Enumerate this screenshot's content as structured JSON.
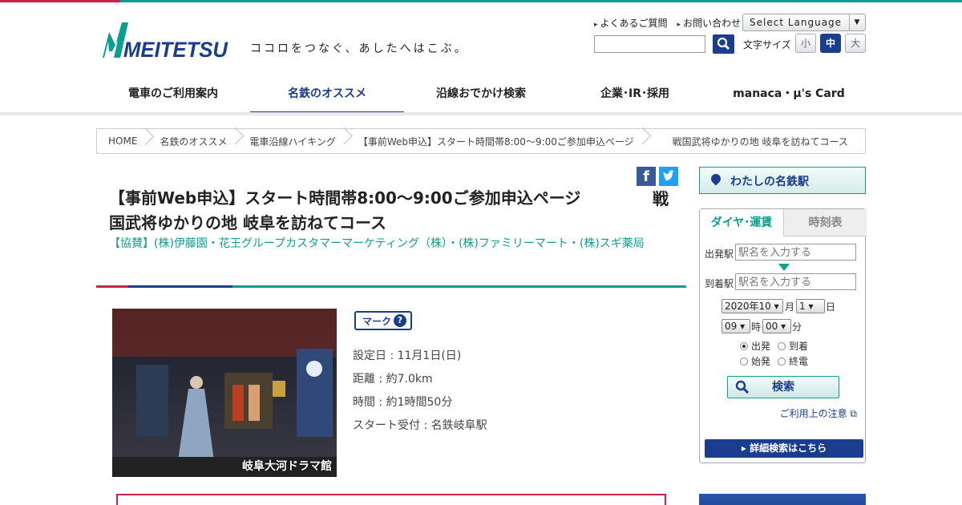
{
  "header": {
    "logo_text": "MEITETSU",
    "tagline": "ココロをつなぐ、あしたへはこぶ。",
    "util_links": [
      "よくあるご質問",
      "お問い合わせ"
    ],
    "language_select": "Select Language",
    "font_size_label": "文字サイズ",
    "font_sizes": [
      "小",
      "中",
      "大"
    ],
    "font_size_selected": "中"
  },
  "nav": {
    "items": [
      "電車のご利用案内",
      "名鉄のオススメ",
      "沿線おでかけ検索",
      "企業･IR･採用",
      "manaca・μ's Card"
    ],
    "active": "名鉄のオススメ"
  },
  "breadcrumb": [
    "HOME",
    "名鉄のオススメ",
    "電車沿線ハイキング",
    "【事前Web申込】スタート時間帯8:00～9:00ご参加申込ページ",
    "戦国武将ゆかりの地 岐阜を訪ねてコース"
  ],
  "main": {
    "title": "【事前Web申込】スタート時間帯8:00～9:00ご参加申込ページ　国武将ゆかりの地 岐阜を訪ねてコース",
    "title_tail": "戦",
    "sponsor": "【協賛】(株)伊藤園・花王グループカスタマーマーケティング（株）・(株)ファミリーマート・(株)スギ薬局",
    "photo_caption": "岐阜大河ドラマ館",
    "mark_label": "マーク",
    "mark_help": "?",
    "info": [
      "設定日 : 11月1日(日)",
      "距離 : 約7.0km",
      "時間 : 約1時間50分",
      "スタート受付 : 名鉄岐阜駅"
    ],
    "fb": "f"
  },
  "sidebar": {
    "my_station": "わたしの名鉄駅",
    "tabs": [
      "ダイヤ･運賃",
      "時刻表"
    ],
    "active_tab": "ダイヤ･運賃",
    "from_label": "出発駅",
    "to_label": "到着駅",
    "placeholder": "駅名を入力する",
    "year_month": "2020年10",
    "month_unit": "月",
    "day": "1",
    "day_unit": "日",
    "hour": "09",
    "hour_unit": "時",
    "minute": "00",
    "minute_unit": "分",
    "radios": [
      "出発",
      "到着",
      "始発",
      "終電"
    ],
    "radio_selected": "出発",
    "search_button": "検索",
    "notice": "ご利用上の注意",
    "detail_button": "詳細検索はこちら"
  },
  "colors": {
    "brand_navy": "#1a3d8f",
    "teal": "#0e9e8f",
    "crimson": "#c8234a"
  }
}
